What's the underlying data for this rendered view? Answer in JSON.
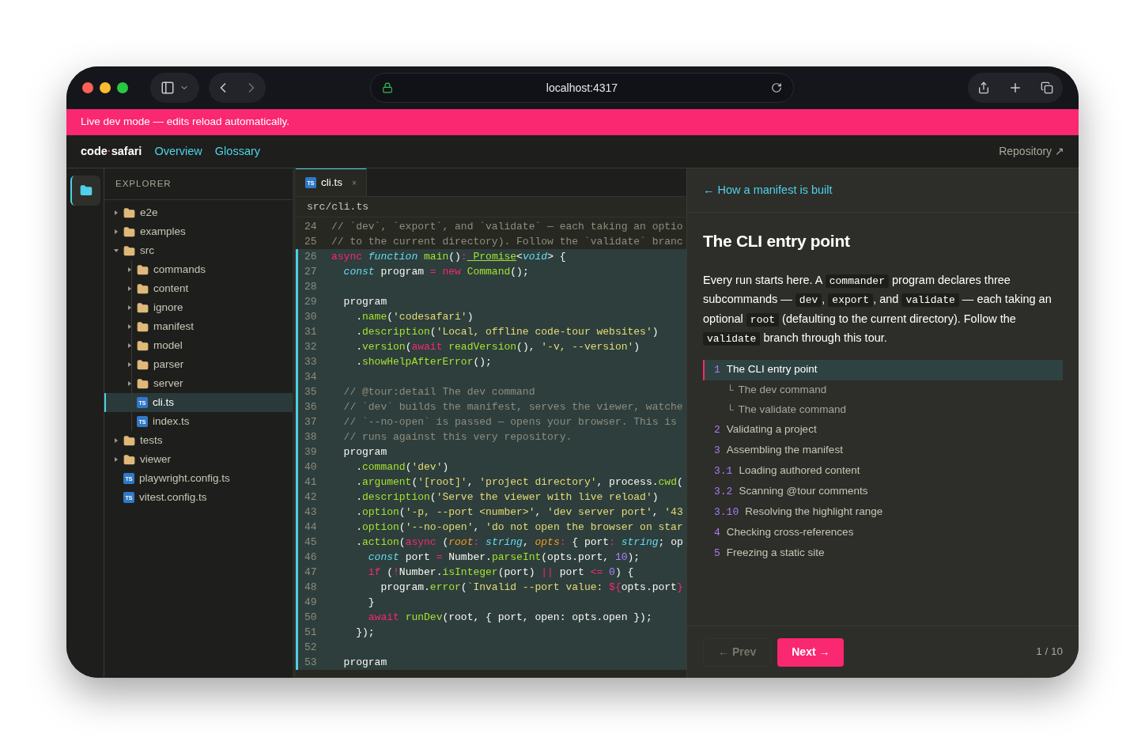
{
  "browser": {
    "url": "localhost:4317"
  },
  "banner": {
    "text": "Live dev mode — edits reload automatically."
  },
  "nav": {
    "brand": [
      {
        "t": "code",
        "accent": false
      },
      {
        "t": "·",
        "accent": true
      },
      {
        "t": "safari",
        "accent": false
      }
    ],
    "links": [
      "Overview",
      "Glossary"
    ],
    "repo": "Repository ↗"
  },
  "explorer": {
    "title": "EXPLORER",
    "tree": [
      {
        "name": "e2e",
        "kind": "folder",
        "expanded": false,
        "selected": false
      },
      {
        "name": "examples",
        "kind": "folder",
        "expanded": false,
        "selected": false
      },
      {
        "name": "src",
        "kind": "folder",
        "expanded": true,
        "selected": false,
        "children": [
          {
            "name": "commands",
            "kind": "folder",
            "expanded": false,
            "selected": false
          },
          {
            "name": "content",
            "kind": "folder",
            "expanded": false,
            "selected": false
          },
          {
            "name": "ignore",
            "kind": "folder",
            "expanded": false,
            "selected": false
          },
          {
            "name": "manifest",
            "kind": "folder",
            "expanded": false,
            "selected": false
          },
          {
            "name": "model",
            "kind": "folder",
            "expanded": false,
            "selected": false
          },
          {
            "name": "parser",
            "kind": "folder",
            "expanded": false,
            "selected": false
          },
          {
            "name": "server",
            "kind": "folder",
            "expanded": false,
            "selected": false
          },
          {
            "name": "cli.ts",
            "kind": "file",
            "badge": "TS",
            "selected": true
          },
          {
            "name": "index.ts",
            "kind": "file",
            "badge": "TS",
            "selected": false
          }
        ]
      },
      {
        "name": "tests",
        "kind": "folder",
        "expanded": false,
        "selected": false
      },
      {
        "name": "viewer",
        "kind": "folder",
        "expanded": false,
        "selected": false
      },
      {
        "name": "playwright.config.ts",
        "kind": "file",
        "badge": "TS",
        "selected": false
      },
      {
        "name": "vitest.config.ts",
        "kind": "file",
        "badge": "TS",
        "selected": false
      }
    ]
  },
  "editor": {
    "tabs": [
      {
        "label": "cli.ts",
        "badge": "TS",
        "close": "×",
        "selected": true
      }
    ],
    "path": "src/cli.ts",
    "lines": [
      {
        "num": "24",
        "highlighted": false,
        "tokens": [
          {
            "t": "// `dev`, `export`, and `validate` — each taking an optio",
            "kind": "comment"
          }
        ]
      },
      {
        "num": "25",
        "highlighted": false,
        "tokens": [
          {
            "t": "// to the current directory). Follow the `validate` branc",
            "kind": "comment"
          }
        ]
      },
      {
        "num": "26",
        "highlighted": true,
        "tokens": [
          {
            "t": "async",
            "kind": "keyword"
          },
          {
            "t": " function",
            "kind": "storage"
          },
          {
            "t": " main",
            "kind": "function"
          },
          {
            "t": "()",
            "kind": "plain"
          },
          {
            "t": ":",
            "kind": "operator"
          },
          {
            "t": " Promise",
            "kind": "type"
          },
          {
            "t": "<",
            "kind": "plain"
          },
          {
            "t": "void",
            "kind": "storage"
          },
          {
            "t": "> {",
            "kind": "plain"
          }
        ]
      },
      {
        "num": "27",
        "highlighted": true,
        "tokens": [
          {
            "t": "  const",
            "kind": "storage"
          },
          {
            "t": " program ",
            "kind": "plain"
          },
          {
            "t": "=",
            "kind": "operator"
          },
          {
            "t": " new",
            "kind": "keyword"
          },
          {
            "t": " Command",
            "kind": "function"
          },
          {
            "t": "();",
            "kind": "plain"
          }
        ]
      },
      {
        "num": "28",
        "highlighted": true
      },
      {
        "num": "29",
        "highlighted": true,
        "tokens": [
          {
            "t": "  program",
            "kind": "plain"
          }
        ]
      },
      {
        "num": "30",
        "highlighted": true,
        "tokens": [
          {
            "t": "    .",
            "kind": "plain"
          },
          {
            "t": "name",
            "kind": "function"
          },
          {
            "t": "(",
            "kind": "plain"
          },
          {
            "t": "'codesafari'",
            "kind": "string"
          },
          {
            "t": ")",
            "kind": "plain"
          }
        ]
      },
      {
        "num": "31",
        "highlighted": true,
        "tokens": [
          {
            "t": "    .",
            "kind": "plain"
          },
          {
            "t": "description",
            "kind": "function"
          },
          {
            "t": "(",
            "kind": "plain"
          },
          {
            "t": "'Local, offline code-tour websites'",
            "kind": "string"
          },
          {
            "t": ")",
            "kind": "plain"
          }
        ]
      },
      {
        "num": "32",
        "highlighted": true,
        "tokens": [
          {
            "t": "    .",
            "kind": "plain"
          },
          {
            "t": "version",
            "kind": "function"
          },
          {
            "t": "(",
            "kind": "plain"
          },
          {
            "t": "await",
            "kind": "keyword"
          },
          {
            "t": " readVersion",
            "kind": "function"
          },
          {
            "t": "(), ",
            "kind": "plain"
          },
          {
            "t": "'-v, --version'",
            "kind": "string"
          },
          {
            "t": ")",
            "kind": "plain"
          }
        ]
      },
      {
        "num": "33",
        "highlighted": true,
        "tokens": [
          {
            "t": "    .",
            "kind": "plain"
          },
          {
            "t": "showHelpAfterError",
            "kind": "function"
          },
          {
            "t": "();",
            "kind": "plain"
          }
        ]
      },
      {
        "num": "34",
        "highlighted": true
      },
      {
        "num": "35",
        "highlighted": true,
        "tokens": [
          {
            "t": "  // @tour:detail The dev command",
            "kind": "comment"
          }
        ]
      },
      {
        "num": "36",
        "highlighted": true,
        "tokens": [
          {
            "t": "  // `dev` builds the manifest, serves the viewer, watche",
            "kind": "comment"
          }
        ]
      },
      {
        "num": "37",
        "highlighted": true,
        "tokens": [
          {
            "t": "  // `--no-open` is passed — opens your browser. This is",
            "kind": "comment"
          }
        ]
      },
      {
        "num": "38",
        "highlighted": true,
        "tokens": [
          {
            "t": "  // runs against this very repository.",
            "kind": "comment"
          }
        ]
      },
      {
        "num": "39",
        "highlighted": true,
        "tokens": [
          {
            "t": "  program",
            "kind": "plain"
          }
        ]
      },
      {
        "num": "40",
        "highlighted": true,
        "tokens": [
          {
            "t": "    .",
            "kind": "plain"
          },
          {
            "t": "command",
            "kind": "function"
          },
          {
            "t": "(",
            "kind": "plain"
          },
          {
            "t": "'dev'",
            "kind": "string"
          },
          {
            "t": ")",
            "kind": "plain"
          }
        ]
      },
      {
        "num": "41",
        "highlighted": true,
        "tokens": [
          {
            "t": "    .",
            "kind": "plain"
          },
          {
            "t": "argument",
            "kind": "function"
          },
          {
            "t": "(",
            "kind": "plain"
          },
          {
            "t": "'[root]'",
            "kind": "string"
          },
          {
            "t": ", ",
            "kind": "plain"
          },
          {
            "t": "'project directory'",
            "kind": "string"
          },
          {
            "t": ", process.",
            "kind": "plain"
          },
          {
            "t": "cwd",
            "kind": "function"
          },
          {
            "t": "(",
            "kind": "plain"
          }
        ]
      },
      {
        "num": "42",
        "highlighted": true,
        "tokens": [
          {
            "t": "    .",
            "kind": "plain"
          },
          {
            "t": "description",
            "kind": "function"
          },
          {
            "t": "(",
            "kind": "plain"
          },
          {
            "t": "'Serve the viewer with live reload'",
            "kind": "string"
          },
          {
            "t": ")",
            "kind": "plain"
          }
        ]
      },
      {
        "num": "43",
        "highlighted": true,
        "tokens": [
          {
            "t": "    .",
            "kind": "plain"
          },
          {
            "t": "option",
            "kind": "function"
          },
          {
            "t": "(",
            "kind": "plain"
          },
          {
            "t": "'-p, --port <number>'",
            "kind": "string"
          },
          {
            "t": ", ",
            "kind": "plain"
          },
          {
            "t": "'dev server port'",
            "kind": "string"
          },
          {
            "t": ", ",
            "kind": "plain"
          },
          {
            "t": "'43",
            "kind": "string"
          }
        ]
      },
      {
        "num": "44",
        "highlighted": true,
        "tokens": [
          {
            "t": "    .",
            "kind": "plain"
          },
          {
            "t": "option",
            "kind": "function"
          },
          {
            "t": "(",
            "kind": "plain"
          },
          {
            "t": "'--no-open'",
            "kind": "string"
          },
          {
            "t": ", ",
            "kind": "plain"
          },
          {
            "t": "'do not open the browser on star",
            "kind": "string"
          }
        ]
      },
      {
        "num": "45",
        "highlighted": true,
        "tokens": [
          {
            "t": "    .",
            "kind": "plain"
          },
          {
            "t": "action",
            "kind": "function"
          },
          {
            "t": "(",
            "kind": "plain"
          },
          {
            "t": "async",
            "kind": "keyword"
          },
          {
            "t": " (",
            "kind": "plain"
          },
          {
            "t": "root",
            "kind": "param"
          },
          {
            "t": ":",
            "kind": "operator"
          },
          {
            "t": " string",
            "kind": "storage"
          },
          {
            "t": ", ",
            "kind": "plain"
          },
          {
            "t": "opts",
            "kind": "param"
          },
          {
            "t": ":",
            "kind": "operator"
          },
          {
            "t": " { port",
            "kind": "plain"
          },
          {
            "t": ":",
            "kind": "operator"
          },
          {
            "t": " string",
            "kind": "storage"
          },
          {
            "t": "; op",
            "kind": "plain"
          }
        ]
      },
      {
        "num": "46",
        "highlighted": true,
        "tokens": [
          {
            "t": "      const",
            "kind": "storage"
          },
          {
            "t": " port ",
            "kind": "plain"
          },
          {
            "t": "=",
            "kind": "operator"
          },
          {
            "t": " Number.",
            "kind": "plain"
          },
          {
            "t": "parseInt",
            "kind": "function"
          },
          {
            "t": "(opts.port, ",
            "kind": "plain"
          },
          {
            "t": "10",
            "kind": "number"
          },
          {
            "t": ");",
            "kind": "plain"
          }
        ]
      },
      {
        "num": "47",
        "highlighted": true,
        "tokens": [
          {
            "t": "      if",
            "kind": "keyword"
          },
          {
            "t": " (",
            "kind": "plain"
          },
          {
            "t": "!",
            "kind": "operator"
          },
          {
            "t": "Number.",
            "kind": "plain"
          },
          {
            "t": "isInteger",
            "kind": "function"
          },
          {
            "t": "(port) ",
            "kind": "plain"
          },
          {
            "t": "||",
            "kind": "operator"
          },
          {
            "t": " port ",
            "kind": "plain"
          },
          {
            "t": "<=",
            "kind": "operator"
          },
          {
            "t": " 0",
            "kind": "number"
          },
          {
            "t": ") {",
            "kind": "plain"
          }
        ]
      },
      {
        "num": "48",
        "highlighted": true,
        "tokens": [
          {
            "t": "        program.",
            "kind": "plain"
          },
          {
            "t": "error",
            "kind": "function"
          },
          {
            "t": "(",
            "kind": "plain"
          },
          {
            "t": "`Invalid --port value: ",
            "kind": "string"
          },
          {
            "t": "${",
            "kind": "operator"
          },
          {
            "t": "opts.port",
            "kind": "plain"
          },
          {
            "t": "}",
            "kind": "operator"
          }
        ]
      },
      {
        "num": "49",
        "highlighted": true,
        "tokens": [
          {
            "t": "      }",
            "kind": "plain"
          }
        ]
      },
      {
        "num": "50",
        "highlighted": true,
        "tokens": [
          {
            "t": "      await",
            "kind": "keyword"
          },
          {
            "t": " runDev",
            "kind": "function"
          },
          {
            "t": "(root, { port, open: opts.open });",
            "kind": "plain"
          }
        ]
      },
      {
        "num": "51",
        "highlighted": true,
        "tokens": [
          {
            "t": "    });",
            "kind": "plain"
          }
        ]
      },
      {
        "num": "52",
        "highlighted": true
      },
      {
        "num": "53",
        "highlighted": true,
        "tokens": [
          {
            "t": "  program",
            "kind": "plain"
          }
        ]
      }
    ]
  },
  "tour": {
    "back": "← How a manifest is built",
    "title": "The CLI entry point",
    "body": [
      {
        "t": "Every run starts here. A ",
        "code": false
      },
      {
        "t": "commander",
        "code": true
      },
      {
        "t": " program declares three subcommands — ",
        "code": false
      },
      {
        "t": "dev",
        "code": true
      },
      {
        "t": ", ",
        "code": false
      },
      {
        "t": "export",
        "code": true
      },
      {
        "t": ", and ",
        "code": false
      },
      {
        "t": "validate",
        "code": true
      },
      {
        "t": " — each taking an optional ",
        "code": false
      },
      {
        "t": "root",
        "code": true
      },
      {
        "t": " (defaulting to the current directory). Follow the ",
        "code": false
      },
      {
        "t": "validate",
        "code": true
      },
      {
        "t": " branch through this tour.",
        "code": false
      }
    ],
    "steps": [
      {
        "num": "1",
        "label": "The CLI entry point",
        "selected": true,
        "children": [
          {
            "marker": "└",
            "label": "The dev command"
          },
          {
            "marker": "└",
            "label": "The validate command"
          }
        ]
      },
      {
        "num": "2",
        "label": "Validating a project",
        "selected": false
      },
      {
        "num": "3",
        "label": "Assembling the manifest",
        "selected": false
      },
      {
        "num": "3.1",
        "label": "Loading authored content",
        "selected": false
      },
      {
        "num": "3.2",
        "label": "Scanning @tour comments",
        "selected": false
      },
      {
        "num": "3.10",
        "label": "Resolving the highlight range",
        "selected": false
      },
      {
        "num": "4",
        "label": "Checking cross-references",
        "selected": false
      },
      {
        "num": "5",
        "label": "Freezing a static site",
        "selected": false
      }
    ],
    "prev": {
      "label": "← Prev",
      "disabled": true
    },
    "next": {
      "label": "Next →",
      "disabled": false
    },
    "counter": "1 / 10"
  }
}
